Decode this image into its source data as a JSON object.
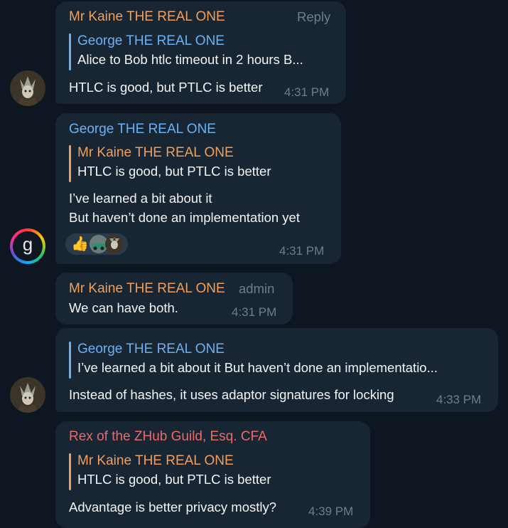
{
  "colors": {
    "background": "#0e1621",
    "bubble": "#182533",
    "orange_name": "#f0a05c",
    "blue_name": "#6ab2f2",
    "red_name": "#e76b6b",
    "meta_gray": "#6d7f8f"
  },
  "messages": [
    {
      "sender": "Mr Kaine THE REAL ONE",
      "action": "Reply",
      "quote_author": "George THE REAL ONE",
      "quote_text": "Alice to Bob htlc timeout in 2 hours B...",
      "text": "HTLC is good, but PTLC is better",
      "time": "4:31 PM",
      "avatar_icon": "joker-avatar-icon"
    },
    {
      "sender": "George THE REAL ONE",
      "quote_author": "Mr Kaine THE REAL ONE",
      "quote_text": "HTLC is good, but PTLC is better",
      "lines": [
        "I’ve learned a bit about it",
        "But haven’t done an implementation yet"
      ],
      "reactions": [
        "thumbs-up-icon",
        "car-avatar-icon",
        "joker-avatar-icon"
      ],
      "time": "4:31 PM",
      "avatar_letter": "g"
    },
    {
      "sender": "Mr Kaine THE REAL ONE",
      "badge": "admin",
      "text": "We can have both.",
      "time": "4:31 PM"
    },
    {
      "quote_author": "George THE REAL ONE",
      "quote_text": "I’ve learned a bit about it But haven’t done an implementatio...",
      "text": "Instead of hashes, it uses adaptor signatures for locking",
      "time": "4:33 PM",
      "avatar_icon": "joker-avatar-icon"
    },
    {
      "sender": "Rex of the ZHub Guild, Esq. CFA",
      "quote_author": "Mr Kaine THE REAL ONE",
      "quote_text": "HTLC is good, but PTLC is better",
      "text": "Advantage is better privacy mostly?",
      "time": "4:39 PM"
    }
  ]
}
